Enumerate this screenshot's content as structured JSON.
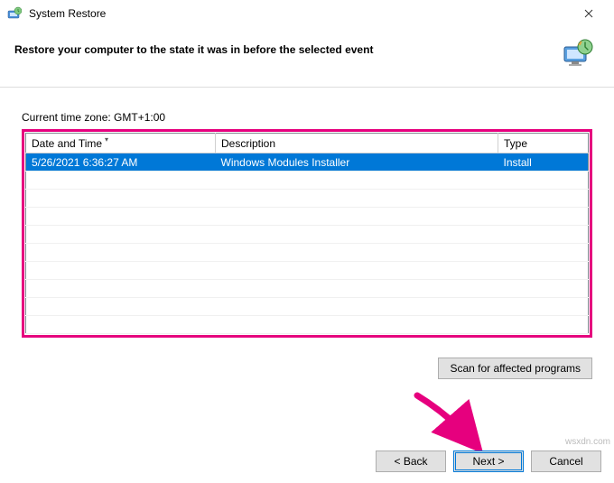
{
  "window": {
    "title": "System Restore",
    "close_tooltip": "Close"
  },
  "header": {
    "heading": "Restore your computer to the state it was in before the selected event"
  },
  "timezone_label": "Current time zone: GMT+1:00",
  "table": {
    "columns": {
      "date": "Date and Time",
      "description": "Description",
      "type": "Type"
    },
    "sort_column": "date",
    "sort_direction": "desc",
    "rows": [
      {
        "date": "5/26/2021 6:36:27 AM",
        "description": "Windows Modules Installer",
        "type": "Install",
        "selected": true
      }
    ],
    "empty_row_count": 9
  },
  "buttons": {
    "scan": "Scan for affected programs",
    "back": "< Back",
    "next": "Next >",
    "cancel": "Cancel"
  },
  "watermark": "wsxdn.com",
  "annotation": {
    "highlight_color": "#e6007e",
    "arrow_target": "next-button"
  }
}
